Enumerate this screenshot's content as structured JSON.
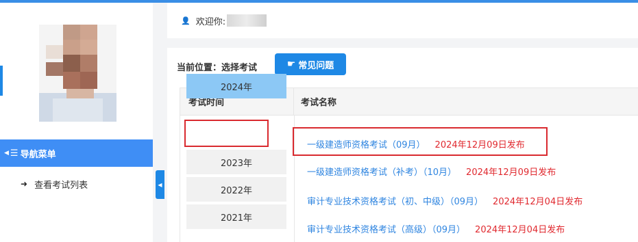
{
  "welcome": {
    "greeting": "欢迎你:",
    "user_icon": "user-icon"
  },
  "sidebar": {
    "nav_header_label": "导航菜单",
    "nav_items": [
      {
        "icon": "sign-in-icon",
        "label": "查看考试列表"
      }
    ]
  },
  "breadcrumb": {
    "label": "当前位置：选择考试"
  },
  "faq_button": {
    "label": "常见问题",
    "icon": "hand-pointer-icon"
  },
  "table": {
    "headers": [
      "考试时间",
      "考试名称"
    ],
    "years": [
      "2024年",
      "2023年",
      "2022年",
      "2021年"
    ],
    "selected_year": "2024年",
    "exams": [
      {
        "name": "一级建造师资格考试（09月）",
        "published": "2024年12月09日发布"
      },
      {
        "name": "一级建造师资格考试（补考）（10月）",
        "published": "2024年12月09日发布"
      },
      {
        "name": "审计专业技术资格考试（初、中级）（09月）",
        "published": "2024年12月04日发布"
      },
      {
        "name": "审计专业技术资格考试（高级）（09月）",
        "published": "2024年12月04日发布"
      }
    ]
  },
  "colors": {
    "accent": "#1e88e5",
    "nav_header": "#3f8ef5",
    "selected_year_bg": "#8cc8f5",
    "link": "#2f85e0",
    "date": "#e0282e",
    "highlight_border": "#d9292e"
  }
}
